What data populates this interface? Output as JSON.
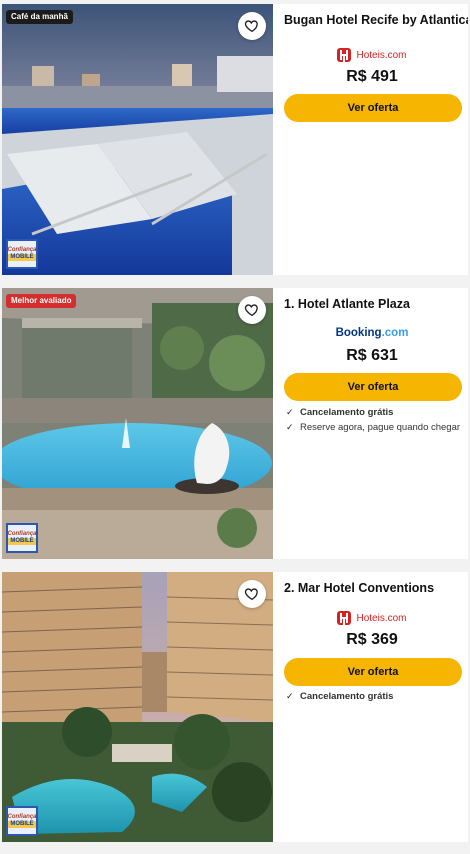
{
  "hotels": [
    {
      "badge": "Café da manhã",
      "name": "Bugan Hotel Recife by Atlantica",
      "provider_name": "Hoteis.com",
      "provider_type": "hoteis",
      "price": "R$ 491",
      "cta": "Ver oferta",
      "perks": []
    },
    {
      "badge": "Melhor avaliado",
      "name": "1. Hotel Atlante Plaza",
      "provider_name": "Booking",
      "provider_suffix": ".com",
      "provider_type": "booking",
      "price": "R$ 631",
      "cta": "Ver oferta",
      "perks": [
        "Cancelamento grátis",
        "Reserve agora, pague quando chegar"
      ]
    },
    {
      "name": "2. Mar Hotel Conventions",
      "provider_name": "Hoteis.com",
      "provider_type": "hoteis",
      "price": "R$ 369",
      "cta": "Ver oferta",
      "perks": [
        "Cancelamento grátis"
      ]
    }
  ],
  "stamp": {
    "top": "Confiança",
    "bottom": "MOBILE"
  },
  "colors": {
    "cta": "#f5b500",
    "badge_red": "#d42e2e",
    "badge_dark": "#1b1b1b",
    "hoteis_red": "#d32323",
    "booking_blue": "#003580"
  }
}
